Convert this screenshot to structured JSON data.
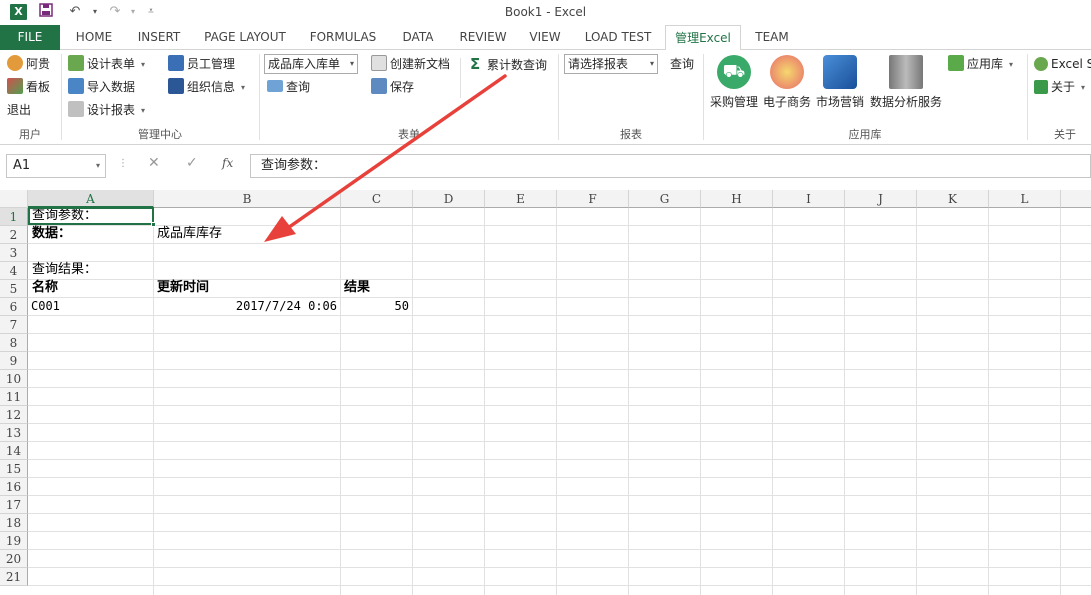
{
  "window": {
    "title": "Book1 - Excel"
  },
  "tabs": [
    {
      "label": "FILE"
    },
    {
      "label": "HOME"
    },
    {
      "label": "INSERT"
    },
    {
      "label": "PAGE LAYOUT"
    },
    {
      "label": "FORMULAS"
    },
    {
      "label": "DATA"
    },
    {
      "label": "REVIEW"
    },
    {
      "label": "VIEW"
    },
    {
      "label": "LOAD TEST"
    },
    {
      "label": "管理Excel"
    },
    {
      "label": "TEAM"
    }
  ],
  "ribbon": {
    "user": {
      "name": "阿贵",
      "board": "看板",
      "logout": "退出",
      "group": "用户"
    },
    "mgmt": {
      "design_form": "设计表单",
      "import": "导入数据",
      "design_report": "设计报表",
      "staff": "员工管理",
      "org": "组织信息",
      "group": "管理中心"
    },
    "forms": {
      "combo": "成品库入库单",
      "query": "查询",
      "new_doc": "创建新文档",
      "save": "保存",
      "group": "表单"
    },
    "cumulative": {
      "label": "累计数查询"
    },
    "reports": {
      "combo": "请选择报表",
      "query": "查询",
      "group": "报表"
    },
    "apps": {
      "items": [
        "采购管理",
        "电子商务",
        "市场营销",
        "数据分析服务"
      ],
      "app_lib": "应用库",
      "group": "应用库"
    },
    "about": {
      "excel_se": "Excel Se",
      "about": "关于",
      "group": "关于"
    }
  },
  "formula_bar": {
    "name_box": "A1",
    "fx": "fx",
    "value": "查询参数："
  },
  "sheet": {
    "columns": [
      "A",
      "B",
      "C",
      "D",
      "E",
      "F",
      "G",
      "H",
      "I",
      "J",
      "K",
      "L"
    ],
    "rows": [
      "1",
      "2",
      "3",
      "4",
      "5",
      "6",
      "7",
      "8",
      "9",
      "10",
      "11",
      "12",
      "13",
      "14",
      "15",
      "16",
      "17",
      "18",
      "19",
      "20",
      "21"
    ],
    "cells": {
      "a1": "查询参数：",
      "a2": "数据：",
      "b2": "成品库库存",
      "a4": "查询结果：",
      "a5": "名称",
      "b5": "更新时间",
      "c5": "结果",
      "a6": "C001",
      "b6": "2017/7/24 0:06",
      "c6": "50"
    }
  },
  "colors": {
    "excel_green": "#217346",
    "arrow_red": "#e8413b"
  }
}
